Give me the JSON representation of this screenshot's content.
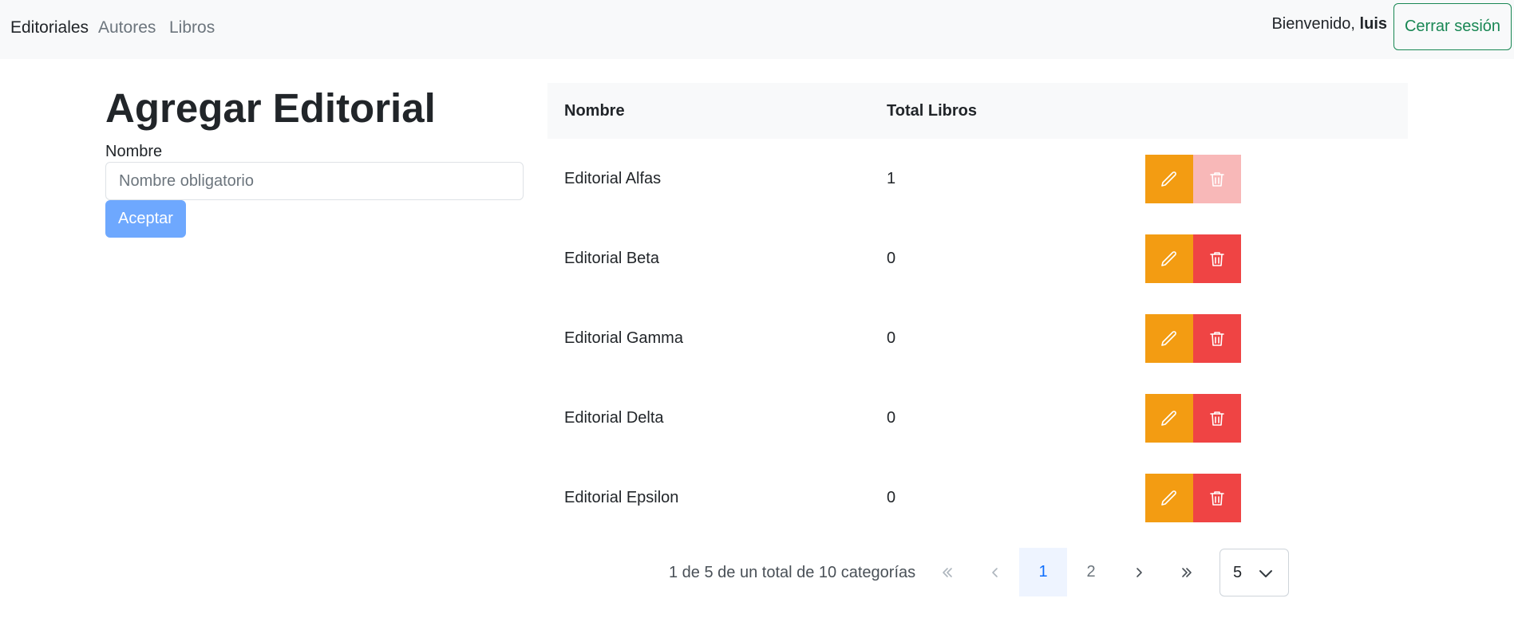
{
  "nav": {
    "items": [
      {
        "label": "Editoriales",
        "active": true
      },
      {
        "label": "Autores",
        "active": false
      },
      {
        "label": "Libros",
        "active": false
      }
    ],
    "welcome_text": "Bienvenido,",
    "username": "luis",
    "logout_label": "Cerrar sesión"
  },
  "form": {
    "title": "Agregar Editorial",
    "name_label": "Nombre",
    "name_placeholder": "Nombre obligatorio",
    "name_value": "",
    "submit_label": "Aceptar"
  },
  "table": {
    "headers": [
      "Nombre",
      "Total Libros"
    ],
    "rows": [
      {
        "name": "Editorial Alfas",
        "total": "1",
        "delete_disabled": true
      },
      {
        "name": "Editorial Beta",
        "total": "0",
        "delete_disabled": false
      },
      {
        "name": "Editorial Gamma",
        "total": "0",
        "delete_disabled": false
      },
      {
        "name": "Editorial Delta",
        "total": "0",
        "delete_disabled": false
      },
      {
        "name": "Editorial Epsilon",
        "total": "0",
        "delete_disabled": false
      }
    ]
  },
  "pagination": {
    "info": "1 de 5 de un total de 10 categorías",
    "pages": [
      "1",
      "2"
    ],
    "current_page": "1",
    "page_size": "5"
  },
  "icons": {
    "edit": "pencil-icon",
    "delete": "trash-icon",
    "first": "double-chevron-left-icon",
    "prev": "chevron-left-icon",
    "next": "chevron-right-icon",
    "last": "double-chevron-right-icon",
    "dropdown": "chevron-down-icon"
  },
  "colors": {
    "edit_button": "#f39c12",
    "delete_button": "#ef4444",
    "delete_button_disabled": "#f8b8b8",
    "accept_button": "#6ea8fe",
    "logout_button": "#198754",
    "active_page_bg": "#eef4ff",
    "active_page_text": "#0d6efd"
  }
}
